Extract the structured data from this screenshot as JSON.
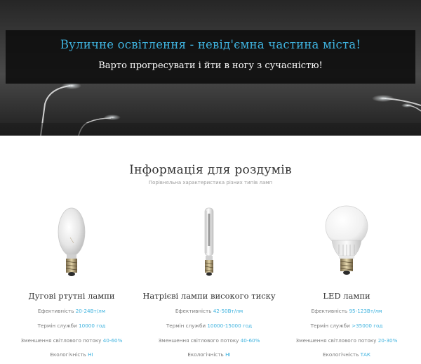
{
  "hero": {
    "title": "Вуличне освітлення - невід'ємна частина міста!",
    "subtitle": "Варто прогресувати і йти в ногу з сучасністю!"
  },
  "section": {
    "title": "Інформація для роздумів",
    "subtitle": "Порівняльна характеристика різних типів ламп"
  },
  "lamps": [
    {
      "icon": "mercury-lamp-icon",
      "name": "Дугові ртутні лампи",
      "specs": [
        {
          "label": "Ефективність",
          "value": "20-24Вт/лм"
        },
        {
          "label": "Термін служби",
          "value": "10000 год"
        },
        {
          "label": "Зменшення світлового потоку",
          "value": "40-60%"
        },
        {
          "label": "Екологічність",
          "value": "НІ"
        }
      ]
    },
    {
      "icon": "sodium-lamp-icon",
      "name": "Натрієві лампи високого тиску",
      "specs": [
        {
          "label": "Ефективність",
          "value": "42-50Вт/лм"
        },
        {
          "label": "Термін служби",
          "value": "10000-15000 год"
        },
        {
          "label": "Зменшення світлового потоку",
          "value": "40-60%"
        },
        {
          "label": "Екологічність",
          "value": "НІ"
        }
      ]
    },
    {
      "icon": "led-lamp-icon",
      "name": "LED лампи",
      "specs": [
        {
          "label": "Ефективність",
          "value": "95-123Вт/лм"
        },
        {
          "label": "Термін служби",
          "value": ">35000 год"
        },
        {
          "label": "Зменшення світлового потоку",
          "value": "20-30%"
        },
        {
          "label": "Екологічність",
          "value": "ТАК"
        }
      ]
    }
  ],
  "colors": {
    "accent": "#3fb3df",
    "heading": "#333333",
    "muted": "#7a7a7a"
  }
}
